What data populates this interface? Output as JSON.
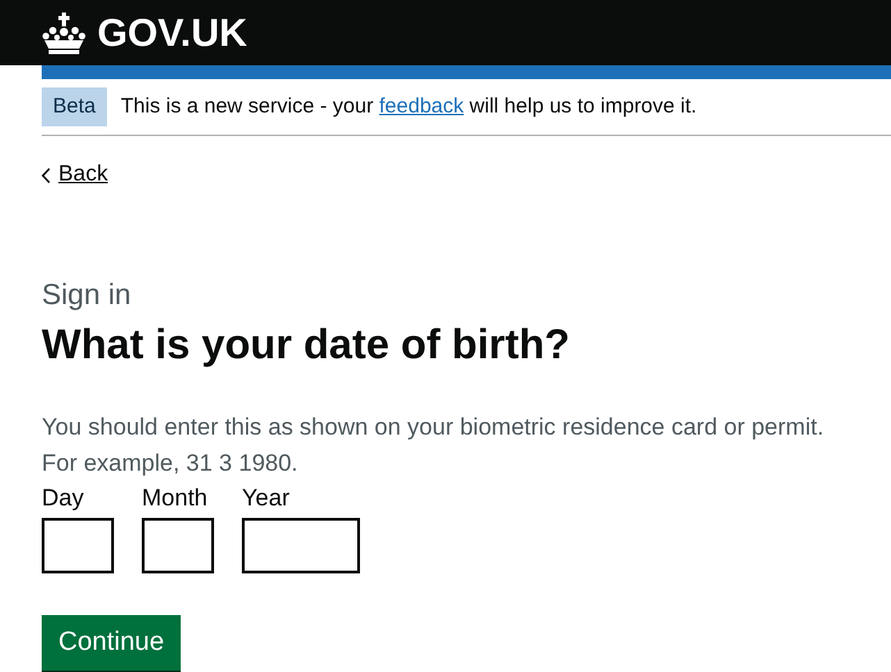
{
  "header": {
    "logo_text": "GOV.UK"
  },
  "phase_banner": {
    "tag": "Beta",
    "text_before": "This is a new service - your ",
    "link": "feedback",
    "text_after": " will help us to improve it."
  },
  "back_link": "Back",
  "caption": "Sign in",
  "heading": "What is your date of birth?",
  "hint": [
    "You should enter this as shown on your biometric residence card or permit.",
    "For example, 31 3 1980."
  ],
  "date_fields": [
    {
      "kind": "day",
      "label": "Day"
    },
    {
      "kind": "month",
      "label": "Month"
    },
    {
      "kind": "year",
      "label": "Year"
    }
  ],
  "button": "Continue"
}
